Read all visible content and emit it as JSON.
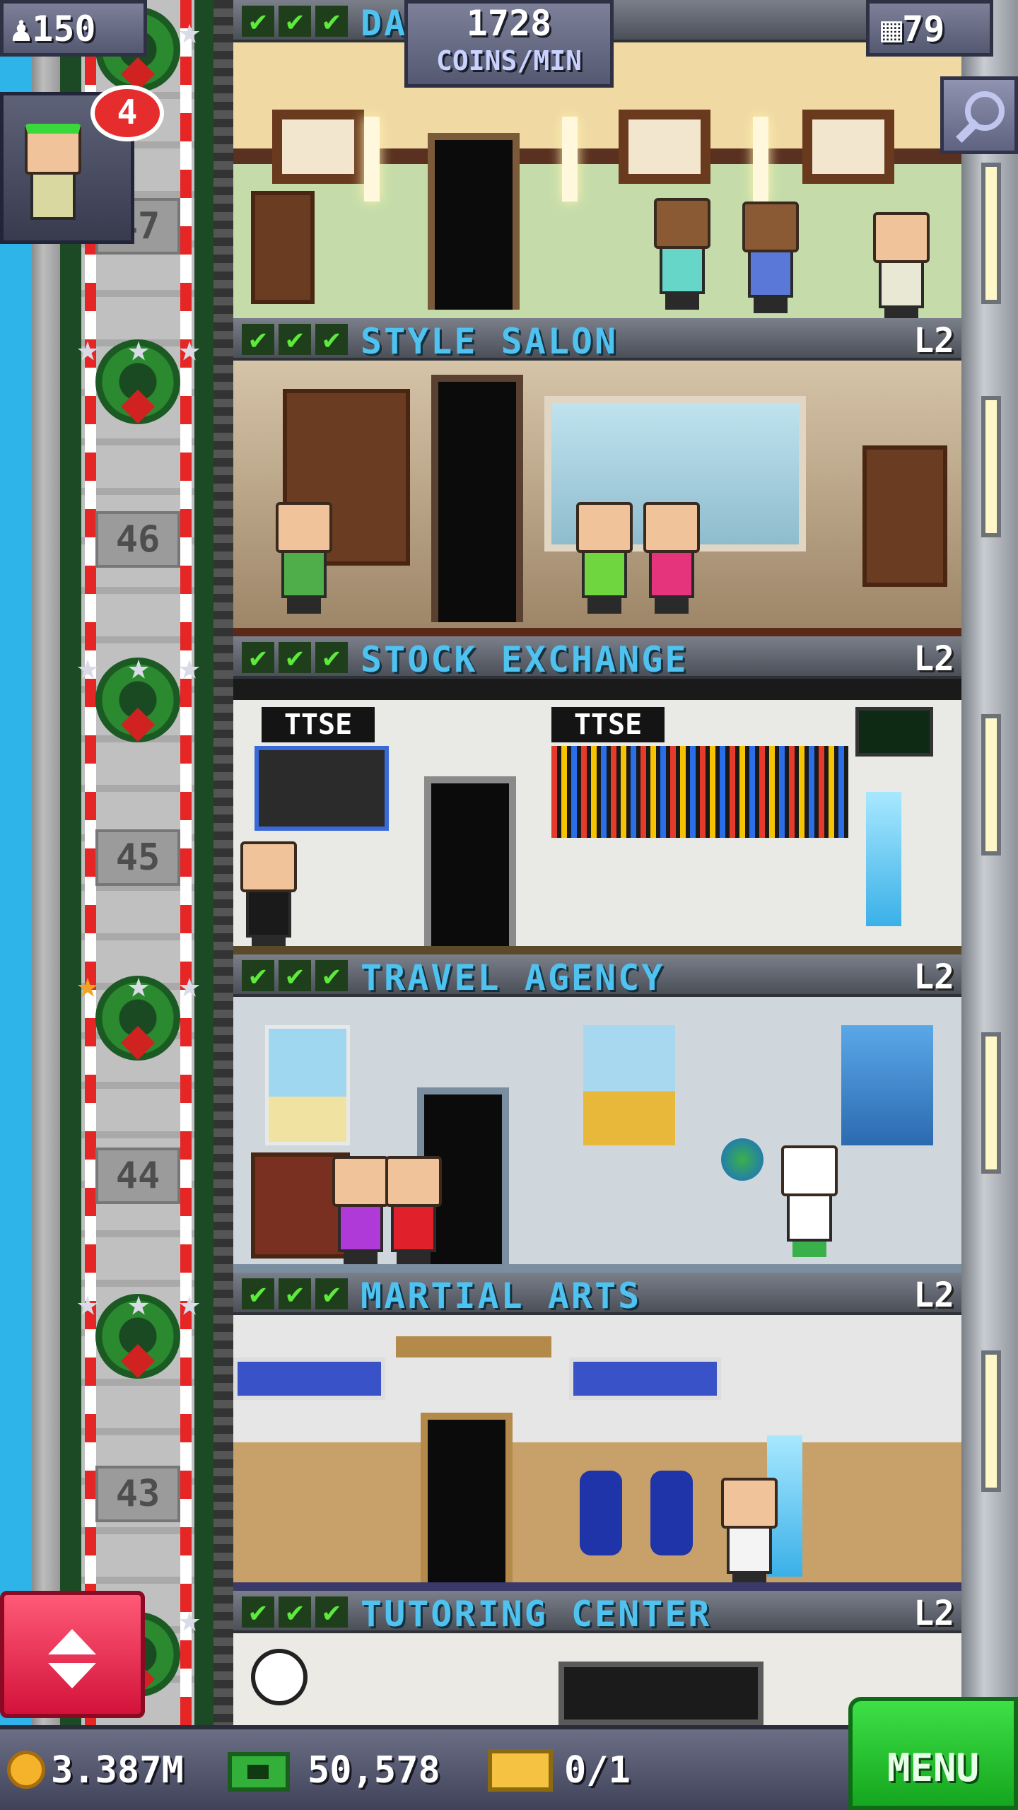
{
  "hud": {
    "population": "150",
    "coins_per_min_value": "1728",
    "coins_per_min_label": "COINS/MIN",
    "floor_count": "79"
  },
  "visitor": {
    "badge_count": "4"
  },
  "elevator": {
    "floor_numbers": [
      "47",
      "46",
      "45",
      "44",
      "43"
    ]
  },
  "top_floor": {
    "name_partial": "DA"
  },
  "floors": [
    {
      "name": "STYLE SALON",
      "level": "L2"
    },
    {
      "name": "STOCK EXCHANGE",
      "level": "L2",
      "sign": "TTSE",
      "sign2": "TTSE"
    },
    {
      "name": "TRAVEL AGENCY",
      "level": "L2"
    },
    {
      "name": "MARTIAL ARTS",
      "level": "L2"
    },
    {
      "name": "TUTORING CENTER",
      "level": "L2"
    }
  ],
  "check_glyph": "✔",
  "bottom": {
    "coins": "3.387M",
    "bux": "50,578",
    "tickets": "0/1",
    "menu_label": "MENU"
  },
  "colors": {
    "floor_name": "#4fc2f0",
    "menu_green": "#1fb82a",
    "lift_red": "#e8254a",
    "badge_red": "#e52d2d"
  },
  "icons": {
    "population": "person-icon",
    "floors": "building-icon",
    "search": "magnifier-icon",
    "coins": "coin-icon",
    "bux": "bux-icon",
    "tickets": "ticket-icon",
    "elevator": "up-down-arrows-icon"
  }
}
